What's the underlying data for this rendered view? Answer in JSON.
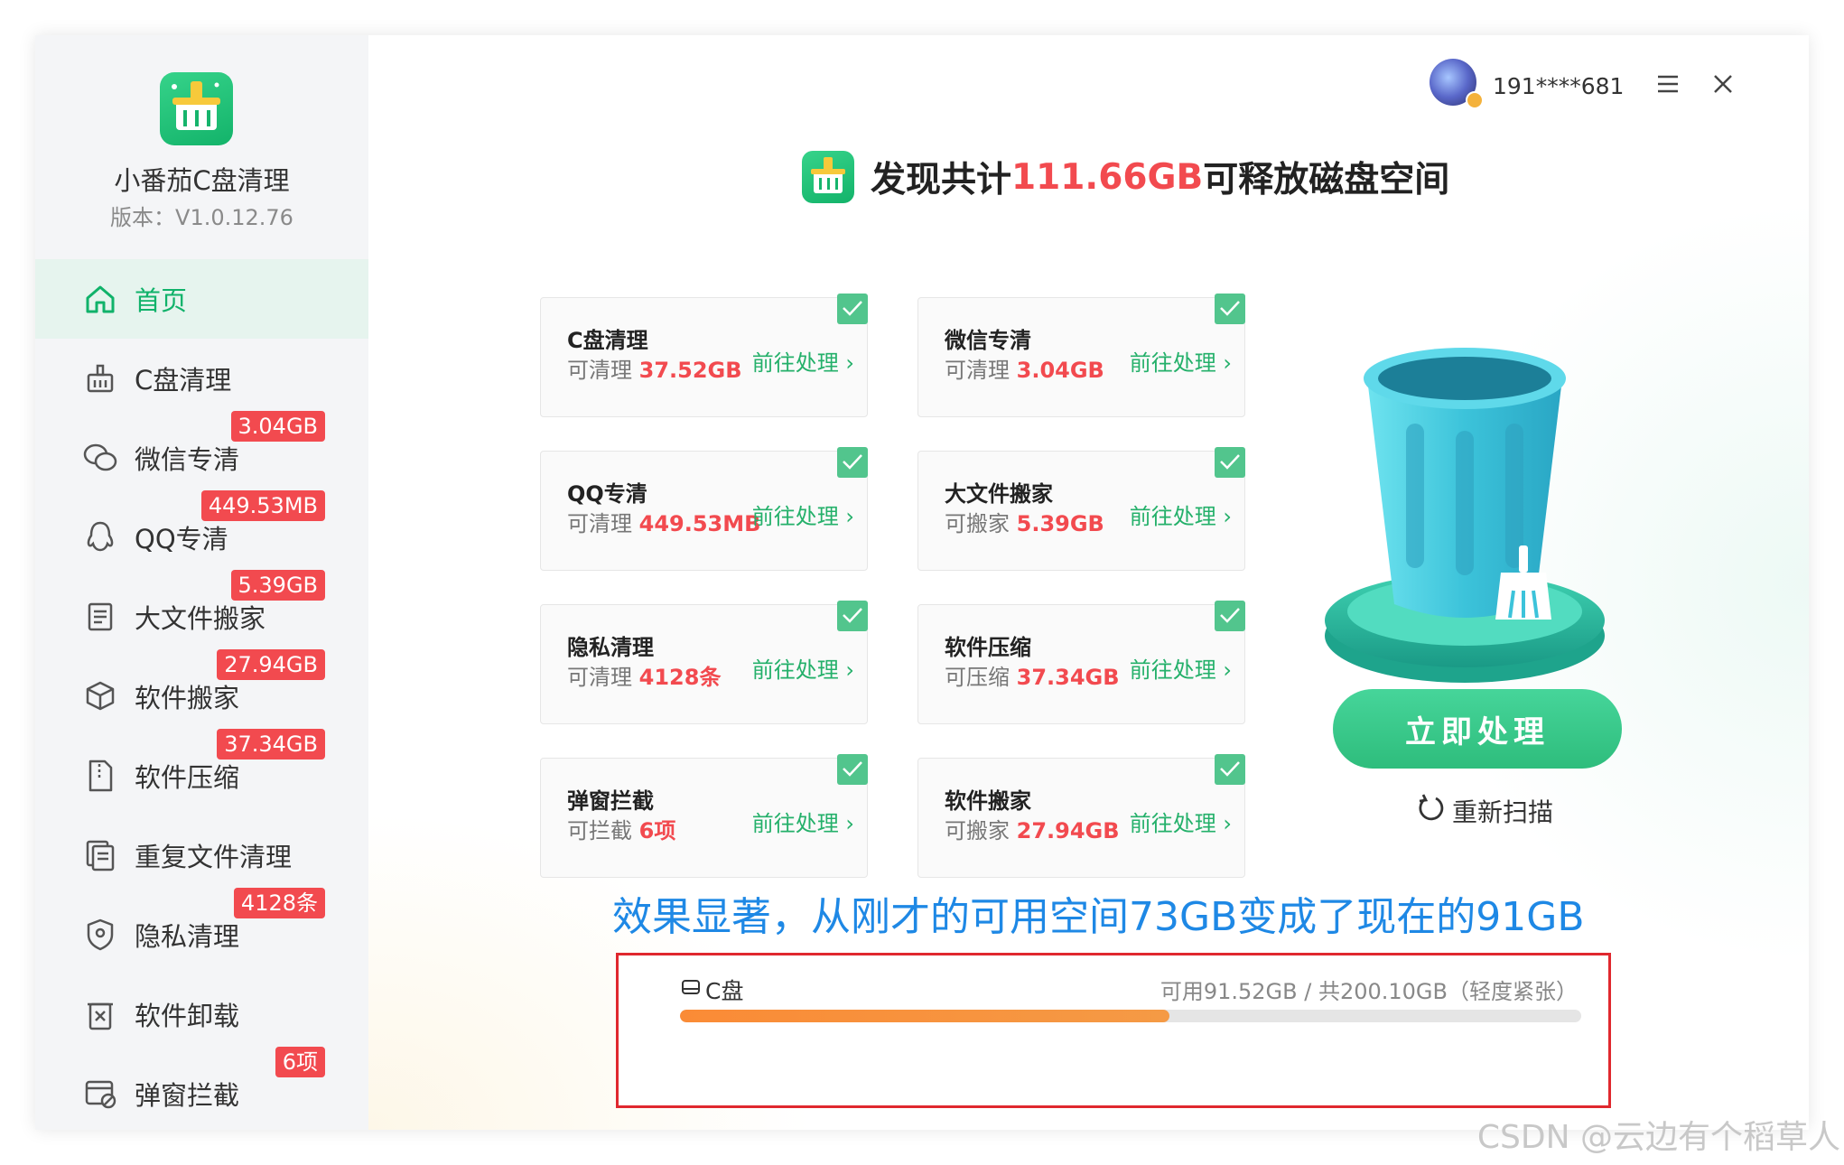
{
  "app": {
    "name": "小番茄C盘清理",
    "version": "版本：V1.0.12.76"
  },
  "sidebar": {
    "items": [
      {
        "label": "首页",
        "icon": "home-icon",
        "active": true,
        "badge": ""
      },
      {
        "label": "C盘清理",
        "icon": "broom-basket-icon",
        "badge": ""
      },
      {
        "label": "微信专清",
        "icon": "wechat-icon",
        "badge": "3.04GB"
      },
      {
        "label": "QQ专清",
        "icon": "qq-icon",
        "badge": "449.53MB"
      },
      {
        "label": "大文件搬家",
        "icon": "document-list-icon",
        "badge": "5.39GB"
      },
      {
        "label": "软件搬家",
        "icon": "package-move-icon",
        "badge": "27.94GB"
      },
      {
        "label": "软件压缩",
        "icon": "zip-file-icon",
        "badge": "37.34GB"
      },
      {
        "label": "重复文件清理",
        "icon": "duplicate-file-icon",
        "badge": ""
      },
      {
        "label": "隐私清理",
        "icon": "shield-icon",
        "badge": "4128条"
      },
      {
        "label": "软件卸载",
        "icon": "uninstall-icon",
        "badge": ""
      },
      {
        "label": "弹窗拦截",
        "icon": "popup-block-icon",
        "badge": "6项"
      }
    ]
  },
  "user": {
    "name": "191****681"
  },
  "headline": {
    "prefix": "发现共计",
    "size": "111.66GB",
    "suffix": "可释放磁盘空间"
  },
  "cards": [
    {
      "title": "C盘清理",
      "label": "可清理",
      "value": "37.52GB",
      "action": "前往处理 ›"
    },
    {
      "title": "微信专清",
      "label": "可清理",
      "value": "3.04GB",
      "action": "前往处理 ›"
    },
    {
      "title": "QQ专清",
      "label": "可清理",
      "value": "449.53MB",
      "action": "前往处理 ›"
    },
    {
      "title": "大文件搬家",
      "label": "可搬家",
      "value": "5.39GB",
      "action": "前往处理 ›"
    },
    {
      "title": "隐私清理",
      "label": "可清理",
      "value": "4128条",
      "action": "前往处理 ›"
    },
    {
      "title": "软件压缩",
      "label": "可压缩",
      "value": "37.34GB",
      "action": "前往处理 ›"
    },
    {
      "title": "弹窗拦截",
      "label": "可拦截",
      "value": "6项",
      "action": "前往处理 ›"
    },
    {
      "title": "软件搬家",
      "label": "可搬家",
      "value": "27.94GB",
      "action": "前往处理 ›"
    }
  ],
  "actions": {
    "primary": "立即处理",
    "rescan": "重新扫描"
  },
  "caption": "效果显著，从刚才的可用空间73GB变成了现在的91GB",
  "disk": {
    "name": "C盘",
    "info": "可用91.52GB /  共200.10GB（轻度紧张）",
    "used_fraction": 0.543
  },
  "watermark": "CSDN @云边有个稻草人",
  "colors": {
    "accent": "#10b26a",
    "danger": "#f24a4f",
    "progress": "#fa8b36",
    "caption": "#1e88e5"
  }
}
